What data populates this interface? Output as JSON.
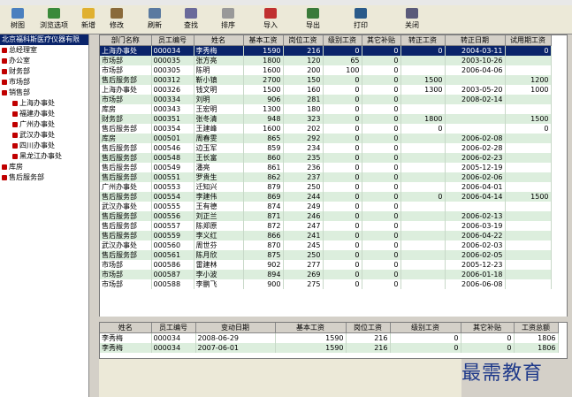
{
  "toolbar": {
    "buttons": [
      {
        "label": "树图"
      },
      {
        "label": "浏览选项"
      },
      {
        "label": "新增"
      },
      {
        "label": "修改"
      },
      {
        "label": "刷新"
      },
      {
        "label": "查找"
      },
      {
        "label": "排序"
      },
      {
        "label": "导入"
      },
      {
        "label": "导出"
      },
      {
        "label": "打印"
      },
      {
        "label": "关闭"
      }
    ]
  },
  "sidebar": {
    "title": "北京福科斯医疗仪器有限",
    "items": [
      {
        "label": "总经理室",
        "level": 0
      },
      {
        "label": "办公室",
        "level": 0
      },
      {
        "label": "财务部",
        "level": 0
      },
      {
        "label": "市场部",
        "level": 0
      },
      {
        "label": "销售部",
        "level": 0
      },
      {
        "label": "上海办事处",
        "level": 1
      },
      {
        "label": "福建办事处",
        "level": 1
      },
      {
        "label": "广州办事处",
        "level": 1
      },
      {
        "label": "武汉办事处",
        "level": 1
      },
      {
        "label": "四川办事处",
        "level": 1
      },
      {
        "label": "黑龙江办事处",
        "level": 1
      },
      {
        "label": "库房",
        "level": 0
      },
      {
        "label": "售后服务部",
        "level": 0
      }
    ]
  },
  "main_table": {
    "columns": [
      "部门名称",
      "员工编号",
      "姓名",
      "基本工资",
      "岗位工资",
      "级别工资",
      "其它补贴",
      "转正工资",
      "转正日期",
      "试用期工资"
    ],
    "rows": [
      [
        "上海办事处",
        "000034",
        "李秀梅",
        "1590",
        "216",
        "0",
        "0",
        "0",
        "2004-03-11",
        "0"
      ],
      [
        "市场部",
        "000035",
        "张方亮",
        "1800",
        "120",
        "65",
        "0",
        "",
        "2003-10-26",
        ""
      ],
      [
        "市场部",
        "000305",
        "陈明",
        "1600",
        "200",
        "100",
        "0",
        "",
        "2006-04-06",
        ""
      ],
      [
        "售后服务部",
        "000312",
        "靳小镇",
        "2700",
        "150",
        "0",
        "0",
        "1500",
        "",
        "1200"
      ],
      [
        "上海办事处",
        "000326",
        "钱文明",
        "1500",
        "160",
        "0",
        "0",
        "1300",
        "2003-05-20",
        "1000"
      ],
      [
        "市场部",
        "000334",
        "刘明",
        "906",
        "281",
        "0",
        "0",
        "",
        "2008-02-14",
        ""
      ],
      [
        "库房",
        "000343",
        "王宏明",
        "1300",
        "180",
        "0",
        "0",
        "",
        "",
        ""
      ],
      [
        "财务部",
        "000351",
        "张冬清",
        "948",
        "323",
        "0",
        "0",
        "1800",
        "",
        "1500"
      ],
      [
        "售后服务部",
        "000354",
        "王建峰",
        "1600",
        "202",
        "0",
        "0",
        "0",
        "",
        "0"
      ],
      [
        "库房",
        "000501",
        "周春雯",
        "865",
        "292",
        "0",
        "0",
        "",
        "2006-02-08",
        ""
      ],
      [
        "售后服务部",
        "000546",
        "边玉军",
        "859",
        "234",
        "0",
        "0",
        "",
        "2006-02-28",
        ""
      ],
      [
        "售后服务部",
        "000548",
        "王长富",
        "860",
        "235",
        "0",
        "0",
        "",
        "2006-02-23",
        ""
      ],
      [
        "售后服务部",
        "000549",
        "潘亮",
        "861",
        "236",
        "0",
        "0",
        "",
        "2005-12-19",
        ""
      ],
      [
        "售后服务部",
        "000551",
        "罗贵生",
        "862",
        "237",
        "0",
        "0",
        "",
        "2006-02-06",
        ""
      ],
      [
        "广州办事处",
        "000553",
        "迁知兴",
        "879",
        "250",
        "0",
        "0",
        "",
        "2006-04-01",
        ""
      ],
      [
        "售后服务部",
        "000554",
        "李建伟",
        "869",
        "244",
        "0",
        "0",
        "0",
        "2006-04-14",
        "1500"
      ],
      [
        "武汉办事处",
        "000555",
        "王有德",
        "874",
        "249",
        "0",
        "0",
        "",
        "",
        ""
      ],
      [
        "售后服务部",
        "000556",
        "刘正兰",
        "871",
        "246",
        "0",
        "0",
        "",
        "2006-02-13",
        ""
      ],
      [
        "售后服务部",
        "000557",
        "陈郑原",
        "872",
        "247",
        "0",
        "0",
        "",
        "2006-03-19",
        ""
      ],
      [
        "售后服务部",
        "000559",
        "李义红",
        "866",
        "241",
        "0",
        "0",
        "",
        "2006-04-22",
        ""
      ],
      [
        "武汉办事处",
        "000560",
        "周世芬",
        "870",
        "245",
        "0",
        "0",
        "",
        "2006-02-03",
        ""
      ],
      [
        "售后服务部",
        "000561",
        "陈月欣",
        "875",
        "250",
        "0",
        "0",
        "",
        "2006-02-05",
        ""
      ],
      [
        "市场部",
        "000586",
        "雷建林",
        "902",
        "277",
        "0",
        "0",
        "",
        "2005-12-23",
        ""
      ],
      [
        "市场部",
        "000587",
        "李小波",
        "894",
        "269",
        "0",
        "0",
        "",
        "2006-01-18",
        ""
      ],
      [
        "市场部",
        "000588",
        "李鹏飞",
        "900",
        "275",
        "0",
        "0",
        "",
        "2006-06-08",
        ""
      ]
    ]
  },
  "detail_table": {
    "columns": [
      "姓名",
      "员工编号",
      "变动日期",
      "基本工资",
      "岗位工资",
      "级别工资",
      "其它补贴",
      "工资总额"
    ],
    "rows": [
      [
        "李秀梅",
        "000034",
        "2008-06-29",
        "1590",
        "216",
        "0",
        "0",
        "1806"
      ],
      [
        "李秀梅",
        "000034",
        "2007-06-01",
        "1590",
        "216",
        "0",
        "0",
        "1806"
      ]
    ]
  },
  "watermark": "最需教育",
  "colors": {
    "selected": "#0a246a",
    "even_row": "#dceedd",
    "toolbar": "#ece9d8"
  }
}
